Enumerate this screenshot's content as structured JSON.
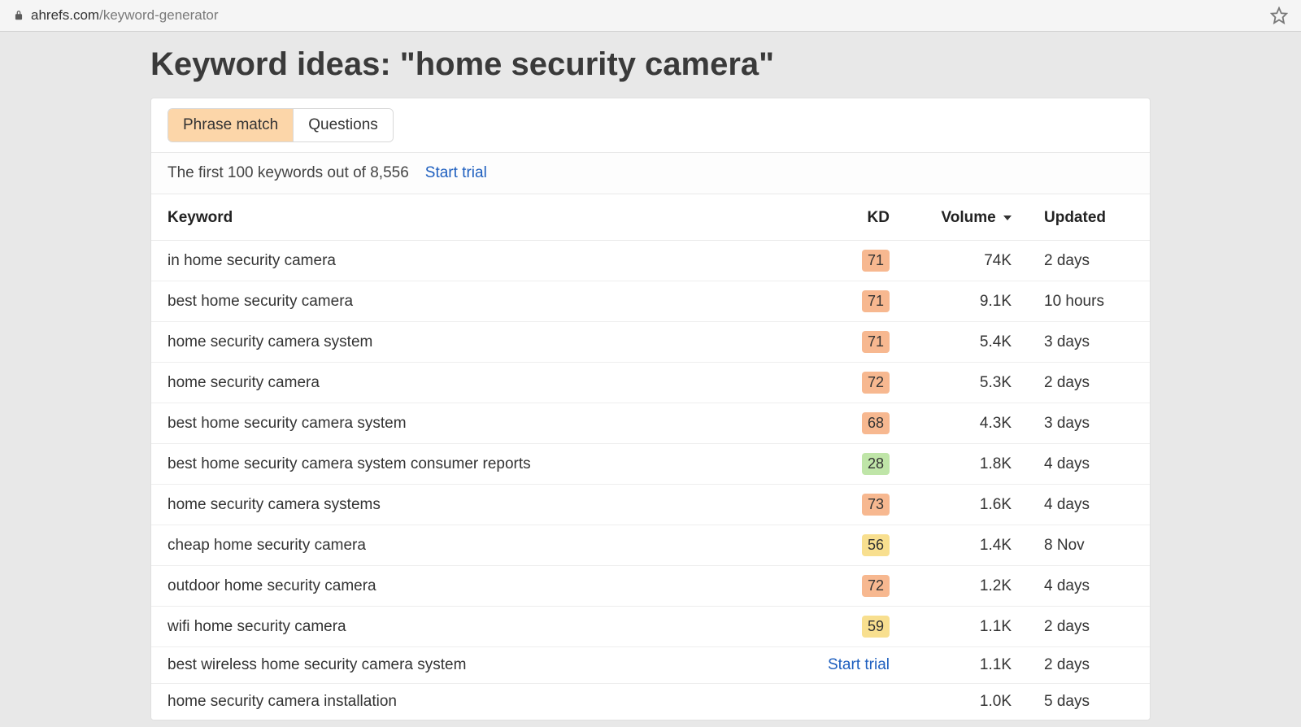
{
  "browser": {
    "domain": "ahrefs.com",
    "path": "/keyword-generator"
  },
  "page": {
    "title": "Keyword ideas: \"home security camera\""
  },
  "tabs": {
    "phrase_match": "Phrase match",
    "questions": "Questions"
  },
  "info": {
    "summary": "The first 100 keywords out of 8,556",
    "start_trial": "Start trial"
  },
  "columns": {
    "keyword": "Keyword",
    "kd": "KD",
    "volume": "Volume",
    "updated": "Updated"
  },
  "trial_inline": "Start trial",
  "kd_colors": {
    "orange": "#f7b890",
    "yellow": "#f8df8f",
    "green": "#bfe5a8"
  },
  "rows": [
    {
      "keyword": "in home security camera",
      "kd": "71",
      "kd_class": "orange",
      "volume": "74K",
      "updated": "2 days"
    },
    {
      "keyword": "best home security camera",
      "kd": "71",
      "kd_class": "orange",
      "volume": "9.1K",
      "updated": "10 hours"
    },
    {
      "keyword": "home security camera system",
      "kd": "71",
      "kd_class": "orange",
      "volume": "5.4K",
      "updated": "3 days"
    },
    {
      "keyword": "home security camera",
      "kd": "72",
      "kd_class": "orange",
      "volume": "5.3K",
      "updated": "2 days"
    },
    {
      "keyword": "best home security camera system",
      "kd": "68",
      "kd_class": "orange",
      "volume": "4.3K",
      "updated": "3 days"
    },
    {
      "keyword": "best home security camera system consumer reports",
      "kd": "28",
      "kd_class": "green",
      "volume": "1.8K",
      "updated": "4 days"
    },
    {
      "keyword": "home security camera systems",
      "kd": "73",
      "kd_class": "orange",
      "volume": "1.6K",
      "updated": "4 days"
    },
    {
      "keyword": "cheap home security camera",
      "kd": "56",
      "kd_class": "yellow",
      "volume": "1.4K",
      "updated": "8 Nov"
    },
    {
      "keyword": "outdoor home security camera",
      "kd": "72",
      "kd_class": "orange",
      "volume": "1.2K",
      "updated": "4 days"
    },
    {
      "keyword": "wifi home security camera",
      "kd": "59",
      "kd_class": "yellow",
      "volume": "1.1K",
      "updated": "2 days"
    },
    {
      "keyword": "best wireless home security camera system",
      "kd": "",
      "kd_class": "",
      "kd_trial": true,
      "volume": "1.1K",
      "updated": "2 days"
    },
    {
      "keyword": "home security camera installation",
      "kd": "",
      "kd_class": "",
      "volume": "1.0K",
      "updated": "5 days"
    }
  ]
}
